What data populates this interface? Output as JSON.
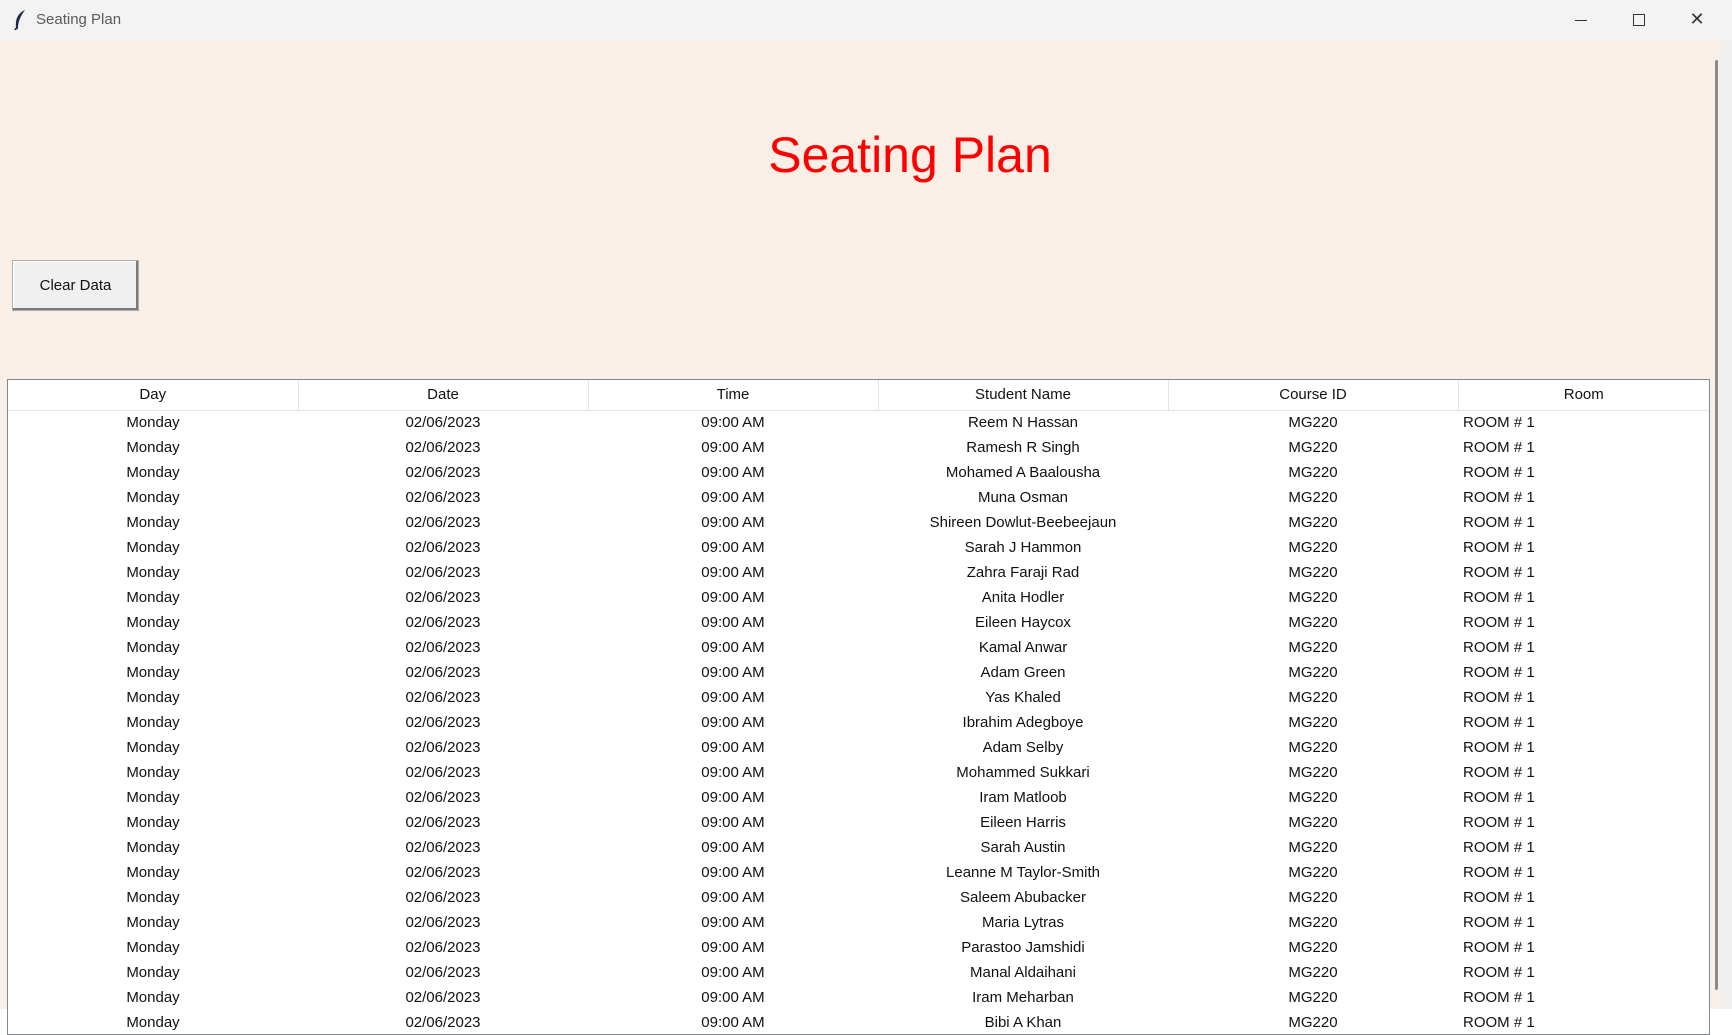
{
  "window": {
    "title": "Seating Plan"
  },
  "heading": "Seating Plan",
  "clear_button_label": "Clear Data",
  "table": {
    "columns": [
      "Day",
      "Date",
      "Time",
      "Student Name",
      "Course ID",
      "Room"
    ],
    "rows": [
      [
        "Monday",
        "02/06/2023",
        "09:00 AM",
        "Reem N Hassan",
        "MG220",
        "ROOM # 1"
      ],
      [
        "Monday",
        "02/06/2023",
        "09:00 AM",
        "Ramesh R Singh",
        "MG220",
        "ROOM # 1"
      ],
      [
        "Monday",
        "02/06/2023",
        "09:00 AM",
        "Mohamed A Baalousha",
        "MG220",
        "ROOM # 1"
      ],
      [
        "Monday",
        "02/06/2023",
        "09:00 AM",
        "Muna Osman",
        "MG220",
        "ROOM # 1"
      ],
      [
        "Monday",
        "02/06/2023",
        "09:00 AM",
        "Shireen Dowlut-Beebeejaun",
        "MG220",
        "ROOM # 1"
      ],
      [
        "Monday",
        "02/06/2023",
        "09:00 AM",
        "Sarah J Hammon",
        "MG220",
        "ROOM # 1"
      ],
      [
        "Monday",
        "02/06/2023",
        "09:00 AM",
        "Zahra Faraji Rad",
        "MG220",
        "ROOM # 1"
      ],
      [
        "Monday",
        "02/06/2023",
        "09:00 AM",
        "Anita Hodler",
        "MG220",
        "ROOM # 1"
      ],
      [
        "Monday",
        "02/06/2023",
        "09:00 AM",
        "Eileen Haycox",
        "MG220",
        "ROOM # 1"
      ],
      [
        "Monday",
        "02/06/2023",
        "09:00 AM",
        "Kamal Anwar",
        "MG220",
        "ROOM # 1"
      ],
      [
        "Monday",
        "02/06/2023",
        "09:00 AM",
        "Adam Green",
        "MG220",
        "ROOM # 1"
      ],
      [
        "Monday",
        "02/06/2023",
        "09:00 AM",
        "Yas Khaled",
        "MG220",
        "ROOM # 1"
      ],
      [
        "Monday",
        "02/06/2023",
        "09:00 AM",
        "Ibrahim Adegboye",
        "MG220",
        "ROOM # 1"
      ],
      [
        "Monday",
        "02/06/2023",
        "09:00 AM",
        "Adam Selby",
        "MG220",
        "ROOM # 1"
      ],
      [
        "Monday",
        "02/06/2023",
        "09:00 AM",
        "Mohammed Sukkari",
        "MG220",
        "ROOM # 1"
      ],
      [
        "Monday",
        "02/06/2023",
        "09:00 AM",
        "Iram Matloob",
        "MG220",
        "ROOM # 1"
      ],
      [
        "Monday",
        "02/06/2023",
        "09:00 AM",
        "Eileen Harris",
        "MG220",
        "ROOM # 1"
      ],
      [
        "Monday",
        "02/06/2023",
        "09:00 AM",
        "Sarah Austin",
        "MG220",
        "ROOM # 1"
      ],
      [
        "Monday",
        "02/06/2023",
        "09:00 AM",
        "Leanne M Taylor-Smith",
        "MG220",
        "ROOM # 1"
      ],
      [
        "Monday",
        "02/06/2023",
        "09:00 AM",
        "Saleem Abubacker",
        "MG220",
        "ROOM # 1"
      ],
      [
        "Monday",
        "02/06/2023",
        "09:00 AM",
        "Maria Lytras",
        "MG220",
        "ROOM # 1"
      ],
      [
        "Monday",
        "02/06/2023",
        "09:00 AM",
        "Parastoo Jamshidi",
        "MG220",
        "ROOM # 1"
      ],
      [
        "Monday",
        "02/06/2023",
        "09:00 AM",
        "Manal Aldaihani",
        "MG220",
        "ROOM # 1"
      ],
      [
        "Monday",
        "02/06/2023",
        "09:00 AM",
        "Iram Meharban",
        "MG220",
        "ROOM # 1"
      ],
      [
        "Monday",
        "02/06/2023",
        "09:00 AM",
        "Bibi A Khan",
        "MG220",
        "ROOM # 1"
      ]
    ]
  },
  "icons": {
    "app": "feather-icon",
    "minimize": "minimize-icon",
    "maximize": "maximize-icon",
    "close": "close-icon"
  },
  "colors": {
    "background": "#faefe7",
    "heading": "#ff0000"
  }
}
